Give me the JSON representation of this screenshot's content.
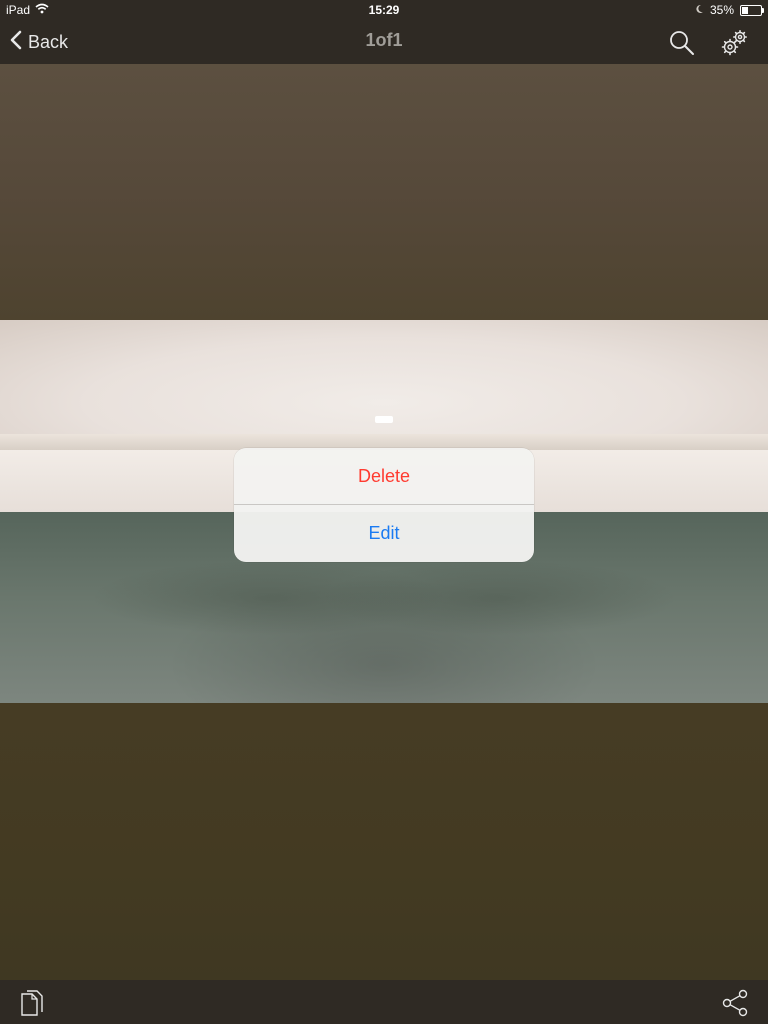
{
  "status_bar": {
    "device": "iPad",
    "time": "15:29",
    "battery_percent": "35%",
    "battery_level": 0.35,
    "icons": [
      "wifi-icon",
      "moon-icon",
      "battery-icon"
    ]
  },
  "nav": {
    "back_label": "Back",
    "title": "1of1",
    "icons": [
      "search-icon",
      "gear-icon"
    ]
  },
  "action_sheet": {
    "delete_label": "Delete",
    "edit_label": "Edit",
    "delete_color": "#ff3b30",
    "edit_color": "#1a7bf2"
  },
  "toolbar": {
    "icons": [
      "copy-icon",
      "share-icon"
    ]
  },
  "colors": {
    "bar_background": "#2f2a24",
    "title_color": "#a09d98"
  }
}
